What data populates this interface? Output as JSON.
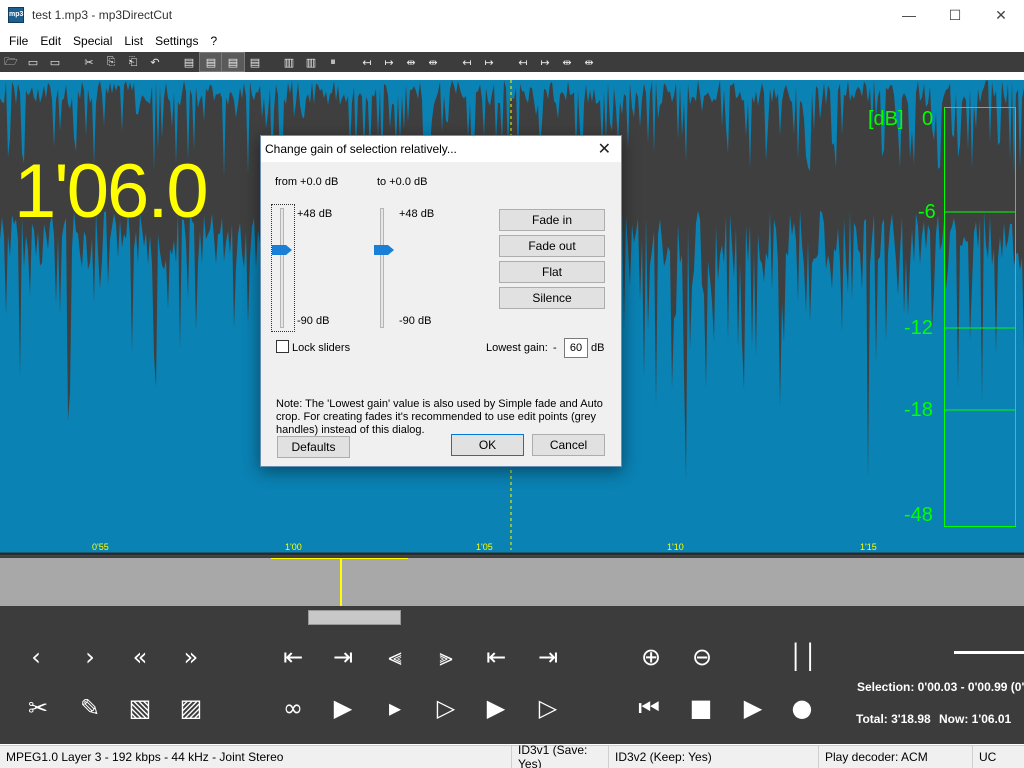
{
  "window": {
    "title": "test 1.mp3 - mp3DirectCut",
    "app_icon_text": "mp3",
    "minimize": "—",
    "maximize": "☐",
    "close": "✕"
  },
  "menu": [
    "File",
    "Edit",
    "Special",
    "List",
    "Settings",
    "?"
  ],
  "toolbar": {
    "icons": [
      "open-icon",
      "save-icon",
      "save-selection-icon",
      "cut-icon",
      "copy-icon",
      "paste-icon",
      "undo-icon",
      "doc-icon",
      "doc-a-icon",
      "doc-b-icon",
      "doc-c-icon",
      "split-icon",
      "split2-icon",
      "pause-icon",
      "mark-left-icon",
      "mark-right-icon",
      "mark-both-icon",
      "mark-both2-icon",
      "mark-set-icon",
      "mark-set2-icon",
      "nav-left-icon",
      "nav-right-icon",
      "nav-both-icon",
      "nav-both2-icon"
    ],
    "glyphs": [
      "🗁",
      "▭",
      "▭",
      "✂",
      "⎘",
      "⎗",
      "↶",
      "▤",
      "▤",
      "▤",
      "▤",
      "▥",
      "▥",
      "⏸",
      "↤",
      "↦",
      "⇹",
      "⇹",
      "↤",
      "↦",
      "↤",
      "↦",
      "⇹",
      "⇹"
    ]
  },
  "waveform": {
    "current_time": "1'06.0",
    "db_unit": "[dB]",
    "db_scale": [
      "0",
      "-6",
      "-12",
      "-18",
      "-48"
    ],
    "timeline": [
      "0'55",
      "1'00",
      "1'05",
      "1'10",
      "1'15"
    ],
    "colors": {
      "wave": "#0a82b4",
      "background": "#3f3f3f",
      "time": "#ffff00",
      "meter": "#00ff00"
    }
  },
  "dialog": {
    "title": "Change gain of selection relatively...",
    "from_label": "from +0.0 dB",
    "to_label": "to +0.0 dB",
    "from_top": "+48 dB",
    "from_bottom": "-90 dB",
    "to_top": "+48 dB",
    "to_bottom": "-90 dB",
    "from_value_fraction": 0.35,
    "to_value_fraction": 0.35,
    "buttons": {
      "fade_in": "Fade in",
      "fade_out": "Fade out",
      "flat": "Flat",
      "silence": "Silence",
      "defaults": "Defaults",
      "ok": "OK",
      "cancel": "Cancel"
    },
    "lock_sliders": "Lock sliders",
    "lowest_gain_label": "Lowest gain:",
    "lowest_gain_minus": "-",
    "lowest_gain_value": "60",
    "lowest_gain_unit": "dB",
    "note": "Note: The 'Lowest gain' value is also used by Simple fade and Auto crop. For creating fades it's recommended to use edit points (grey handles) instead of this dialog."
  },
  "controls": {
    "selection": "Selection: 0'00.03 - 0'00.99 (0'",
    "total": "Total: 3'18.98",
    "now": "Now: 1'06.01"
  },
  "statusbar": {
    "format": "MPEG1.0 Layer 3 - 192 kbps - 44 kHz - Joint Stereo",
    "id3v1": "ID3v1 (Save: Yes)",
    "id3v2": "ID3v2 (Keep: Yes)",
    "decoder": "Play decoder: ACM",
    "mode": "UC"
  }
}
